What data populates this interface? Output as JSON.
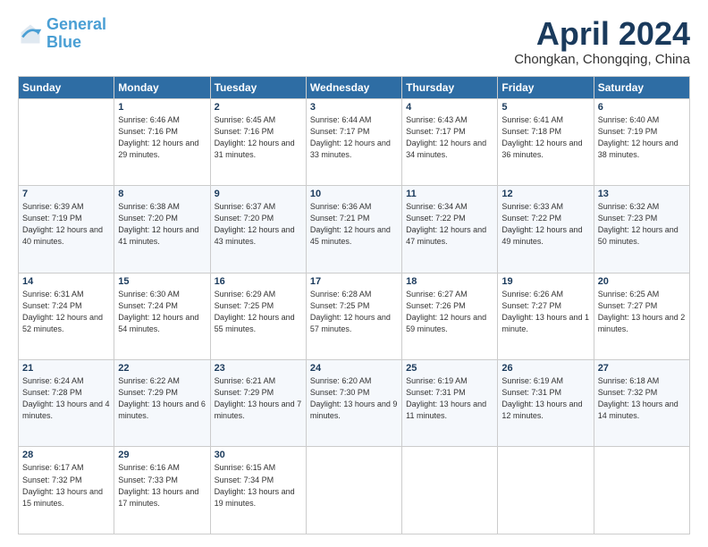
{
  "logo": {
    "line1": "General",
    "line2": "Blue"
  },
  "title": "April 2024",
  "subtitle": "Chongkan, Chongqing, China",
  "header_days": [
    "Sunday",
    "Monday",
    "Tuesday",
    "Wednesday",
    "Thursday",
    "Friday",
    "Saturday"
  ],
  "weeks": [
    [
      {
        "day": "",
        "sunrise": "",
        "sunset": "",
        "daylight": ""
      },
      {
        "day": "1",
        "sunrise": "Sunrise: 6:46 AM",
        "sunset": "Sunset: 7:16 PM",
        "daylight": "Daylight: 12 hours and 29 minutes."
      },
      {
        "day": "2",
        "sunrise": "Sunrise: 6:45 AM",
        "sunset": "Sunset: 7:16 PM",
        "daylight": "Daylight: 12 hours and 31 minutes."
      },
      {
        "day": "3",
        "sunrise": "Sunrise: 6:44 AM",
        "sunset": "Sunset: 7:17 PM",
        "daylight": "Daylight: 12 hours and 33 minutes."
      },
      {
        "day": "4",
        "sunrise": "Sunrise: 6:43 AM",
        "sunset": "Sunset: 7:17 PM",
        "daylight": "Daylight: 12 hours and 34 minutes."
      },
      {
        "day": "5",
        "sunrise": "Sunrise: 6:41 AM",
        "sunset": "Sunset: 7:18 PM",
        "daylight": "Daylight: 12 hours and 36 minutes."
      },
      {
        "day": "6",
        "sunrise": "Sunrise: 6:40 AM",
        "sunset": "Sunset: 7:19 PM",
        "daylight": "Daylight: 12 hours and 38 minutes."
      }
    ],
    [
      {
        "day": "7",
        "sunrise": "Sunrise: 6:39 AM",
        "sunset": "Sunset: 7:19 PM",
        "daylight": "Daylight: 12 hours and 40 minutes."
      },
      {
        "day": "8",
        "sunrise": "Sunrise: 6:38 AM",
        "sunset": "Sunset: 7:20 PM",
        "daylight": "Daylight: 12 hours and 41 minutes."
      },
      {
        "day": "9",
        "sunrise": "Sunrise: 6:37 AM",
        "sunset": "Sunset: 7:20 PM",
        "daylight": "Daylight: 12 hours and 43 minutes."
      },
      {
        "day": "10",
        "sunrise": "Sunrise: 6:36 AM",
        "sunset": "Sunset: 7:21 PM",
        "daylight": "Daylight: 12 hours and 45 minutes."
      },
      {
        "day": "11",
        "sunrise": "Sunrise: 6:34 AM",
        "sunset": "Sunset: 7:22 PM",
        "daylight": "Daylight: 12 hours and 47 minutes."
      },
      {
        "day": "12",
        "sunrise": "Sunrise: 6:33 AM",
        "sunset": "Sunset: 7:22 PM",
        "daylight": "Daylight: 12 hours and 49 minutes."
      },
      {
        "day": "13",
        "sunrise": "Sunrise: 6:32 AM",
        "sunset": "Sunset: 7:23 PM",
        "daylight": "Daylight: 12 hours and 50 minutes."
      }
    ],
    [
      {
        "day": "14",
        "sunrise": "Sunrise: 6:31 AM",
        "sunset": "Sunset: 7:24 PM",
        "daylight": "Daylight: 12 hours and 52 minutes."
      },
      {
        "day": "15",
        "sunrise": "Sunrise: 6:30 AM",
        "sunset": "Sunset: 7:24 PM",
        "daylight": "Daylight: 12 hours and 54 minutes."
      },
      {
        "day": "16",
        "sunrise": "Sunrise: 6:29 AM",
        "sunset": "Sunset: 7:25 PM",
        "daylight": "Daylight: 12 hours and 55 minutes."
      },
      {
        "day": "17",
        "sunrise": "Sunrise: 6:28 AM",
        "sunset": "Sunset: 7:25 PM",
        "daylight": "Daylight: 12 hours and 57 minutes."
      },
      {
        "day": "18",
        "sunrise": "Sunrise: 6:27 AM",
        "sunset": "Sunset: 7:26 PM",
        "daylight": "Daylight: 12 hours and 59 minutes."
      },
      {
        "day": "19",
        "sunrise": "Sunrise: 6:26 AM",
        "sunset": "Sunset: 7:27 PM",
        "daylight": "Daylight: 13 hours and 1 minute."
      },
      {
        "day": "20",
        "sunrise": "Sunrise: 6:25 AM",
        "sunset": "Sunset: 7:27 PM",
        "daylight": "Daylight: 13 hours and 2 minutes."
      }
    ],
    [
      {
        "day": "21",
        "sunrise": "Sunrise: 6:24 AM",
        "sunset": "Sunset: 7:28 PM",
        "daylight": "Daylight: 13 hours and 4 minutes."
      },
      {
        "day": "22",
        "sunrise": "Sunrise: 6:22 AM",
        "sunset": "Sunset: 7:29 PM",
        "daylight": "Daylight: 13 hours and 6 minutes."
      },
      {
        "day": "23",
        "sunrise": "Sunrise: 6:21 AM",
        "sunset": "Sunset: 7:29 PM",
        "daylight": "Daylight: 13 hours and 7 minutes."
      },
      {
        "day": "24",
        "sunrise": "Sunrise: 6:20 AM",
        "sunset": "Sunset: 7:30 PM",
        "daylight": "Daylight: 13 hours and 9 minutes."
      },
      {
        "day": "25",
        "sunrise": "Sunrise: 6:19 AM",
        "sunset": "Sunset: 7:31 PM",
        "daylight": "Daylight: 13 hours and 11 minutes."
      },
      {
        "day": "26",
        "sunrise": "Sunrise: 6:19 AM",
        "sunset": "Sunset: 7:31 PM",
        "daylight": "Daylight: 13 hours and 12 minutes."
      },
      {
        "day": "27",
        "sunrise": "Sunrise: 6:18 AM",
        "sunset": "Sunset: 7:32 PM",
        "daylight": "Daylight: 13 hours and 14 minutes."
      }
    ],
    [
      {
        "day": "28",
        "sunrise": "Sunrise: 6:17 AM",
        "sunset": "Sunset: 7:32 PM",
        "daylight": "Daylight: 13 hours and 15 minutes."
      },
      {
        "day": "29",
        "sunrise": "Sunrise: 6:16 AM",
        "sunset": "Sunset: 7:33 PM",
        "daylight": "Daylight: 13 hours and 17 minutes."
      },
      {
        "day": "30",
        "sunrise": "Sunrise: 6:15 AM",
        "sunset": "Sunset: 7:34 PM",
        "daylight": "Daylight: 13 hours and 19 minutes."
      },
      {
        "day": "",
        "sunrise": "",
        "sunset": "",
        "daylight": ""
      },
      {
        "day": "",
        "sunrise": "",
        "sunset": "",
        "daylight": ""
      },
      {
        "day": "",
        "sunrise": "",
        "sunset": "",
        "daylight": ""
      },
      {
        "day": "",
        "sunrise": "",
        "sunset": "",
        "daylight": ""
      }
    ]
  ]
}
